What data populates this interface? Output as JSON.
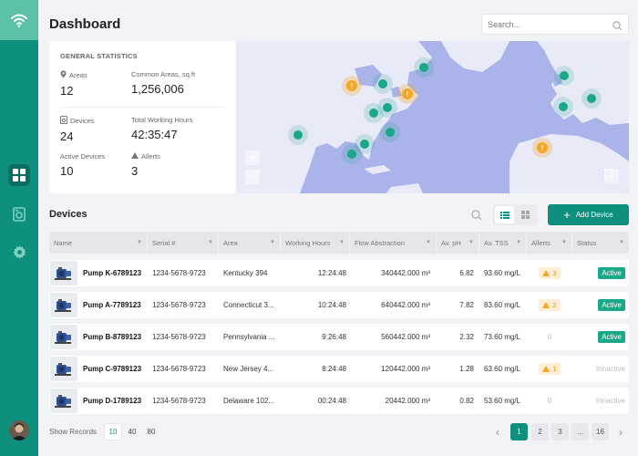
{
  "header": {
    "title": "Dashboard",
    "search_placeholder": "Search..."
  },
  "stats": {
    "heading": "GENERAL STATISTICS",
    "areas_label": "Areas",
    "areas_value": "12",
    "common_areas_label": "Common Areas, sq.ft",
    "common_areas_value": "1,256,006",
    "devices_label": "Devices",
    "devices_value": "24",
    "working_hours_label": "Total Working Hours",
    "working_hours_value": "42:35:47",
    "active_devices_label": "Active Devices",
    "active_devices_value": "10",
    "alerts_label": "Allerts",
    "alerts_value": "3"
  },
  "map": {
    "zoom_in": "+",
    "zoom_out": "−",
    "teal_marker_color": "#1aa88a",
    "alert_marker_color": "#f5a623"
  },
  "devices": {
    "title": "Devices",
    "add_label": "Add Device",
    "columns": [
      "Name",
      "Serial #",
      "Area",
      "Working Hours",
      "Flow Abstraction",
      "Av. pH",
      "Av. TSS",
      "Allerts",
      "Status"
    ],
    "rows": [
      {
        "name": "Pump K-6789123",
        "serial": "1234-5678-9723",
        "area": "Kentucky 394",
        "hours": "12:24:48",
        "flow": "340442.000 m³",
        "ph": "6.82",
        "tss": "93.60 mg/L",
        "alerts": "3",
        "status": "Active"
      },
      {
        "name": "Pump A-7789123",
        "serial": "1234-5678-9723",
        "area": "Connecticut 3...",
        "hours": "10:24:48",
        "flow": "640442.000 m³",
        "ph": "7.82",
        "tss": "83.60 mg/L",
        "alerts": "2",
        "status": "Active"
      },
      {
        "name": "Pump B-8789123",
        "serial": "1234-5678-9723",
        "area": "Pennsylvania ...",
        "hours": "9:26:48",
        "flow": "560442.000 m³",
        "ph": "2.32",
        "tss": "73.60 mg/L",
        "alerts": "0",
        "status": "Active"
      },
      {
        "name": "Pump C-9789123",
        "serial": "1234-5678-9723",
        "area": "New Jersey 4...",
        "hours": "8:24:48",
        "flow": "120442.000 m³",
        "ph": "1.28",
        "tss": "63.60 mg/L",
        "alerts": "1",
        "status": "Innactive"
      },
      {
        "name": "Pump D-1789123",
        "serial": "1234-5678-9723",
        "area": "Delaware 102...",
        "hours": "00:24:48",
        "flow": "20442.000 m³",
        "ph": "0.82",
        "tss": "53.60 mg/L",
        "alerts": "0",
        "status": "Innactive"
      }
    ]
  },
  "footer": {
    "show_records_label": "Show Records",
    "record_options": [
      "10",
      "40",
      "80"
    ],
    "pages": [
      "1",
      "2",
      "3",
      "...",
      "16"
    ],
    "prev_arrow": "‹",
    "next_arrow": "›"
  },
  "colors": {
    "brand": "#0f8f7e",
    "active_badge": "#1aa88a",
    "alert_badge_bg": "#fdeed4",
    "alert_badge_fg": "#e68c00",
    "map_water": "#aab3ea",
    "map_land": "#e9eaf8"
  }
}
